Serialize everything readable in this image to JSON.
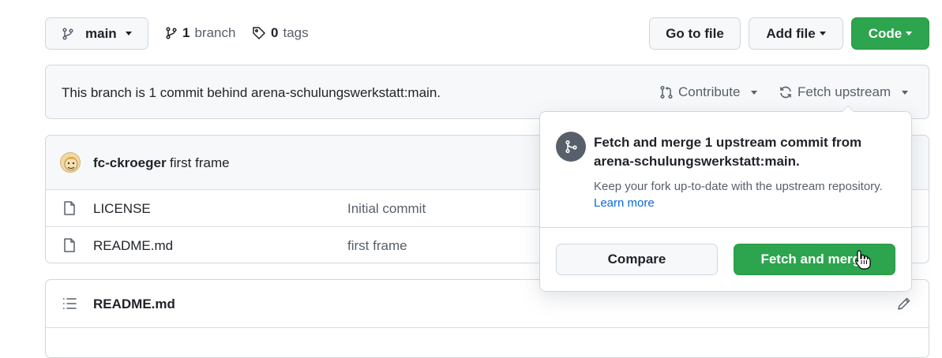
{
  "toolbar": {
    "branch_select": "main",
    "branches_count": "1",
    "branches_label": "branch",
    "tags_count": "0",
    "tags_label": "tags",
    "go_to_file": "Go to file",
    "add_file": "Add file",
    "code": "Code"
  },
  "fork_banner": {
    "message": "This branch is 1 commit behind arena-schulungswerkstatt:main.",
    "contribute": "Contribute",
    "fetch_upstream": "Fetch upstream"
  },
  "commit": {
    "author": "fc-ckroeger",
    "message": "first frame"
  },
  "files": [
    {
      "name": "LICENSE",
      "commit": "Initial commit"
    },
    {
      "name": "README.md",
      "commit": "first frame"
    }
  ],
  "readme": {
    "title": "README.md"
  },
  "popover": {
    "title": "Fetch and merge 1 upstream commit from arena-schulungswerkstatt:main.",
    "description": "Keep your fork up-to-date with the upstream repository.",
    "learn_more": "Learn more",
    "compare": "Compare",
    "fetch_and_merge": "Fetch and merge"
  },
  "colors": {
    "primary_green": "#2da44e",
    "link_blue": "#0969da",
    "border": "#d0d7de",
    "muted_text": "#57606a",
    "banner_bg": "#f6f8fa"
  }
}
